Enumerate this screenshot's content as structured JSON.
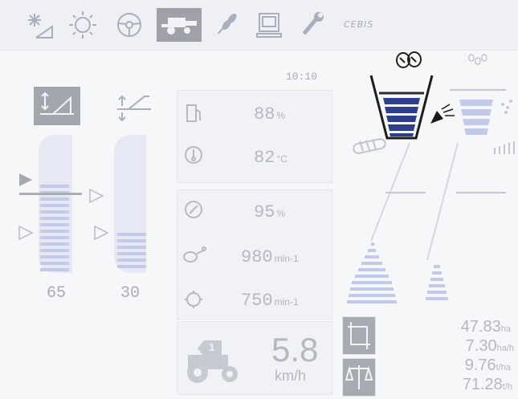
{
  "topbar": {
    "icons": [
      "lighting-icon",
      "sun-icon",
      "steering-wheel-icon",
      "harvester-icon",
      "grain-icon",
      "terminal-icon",
      "wrench-icon"
    ],
    "active": "harvester-icon",
    "brand": "CEBIS"
  },
  "left_gauges": [
    {
      "value": "65",
      "level": 0.65
    },
    {
      "value": "30",
      "level": 0.3
    }
  ],
  "clock": "10:10",
  "engine": {
    "fuel": {
      "value": "88",
      "unit": "%"
    },
    "coolant_temp": {
      "value": "82",
      "unit": "°C"
    },
    "engine_load": {
      "value": "95",
      "unit": "%"
    },
    "engine_speed": {
      "value": "980",
      "unit": "min-1"
    },
    "drum_speed": {
      "value": "750",
      "unit": "min-1"
    }
  },
  "speed": {
    "value": "5.8",
    "unit": "km/h"
  },
  "gear": "1",
  "stats": [
    {
      "value": "47.83",
      "unit": "ha"
    },
    {
      "value": "7.30",
      "unit": "ha/h"
    },
    {
      "value": "9.76",
      "unit": "t/ha"
    },
    {
      "value": "71.28",
      "unit": "t/h"
    }
  ],
  "colors": {
    "accent": "#2e3e8f",
    "gauge": "#c5cbe8"
  }
}
